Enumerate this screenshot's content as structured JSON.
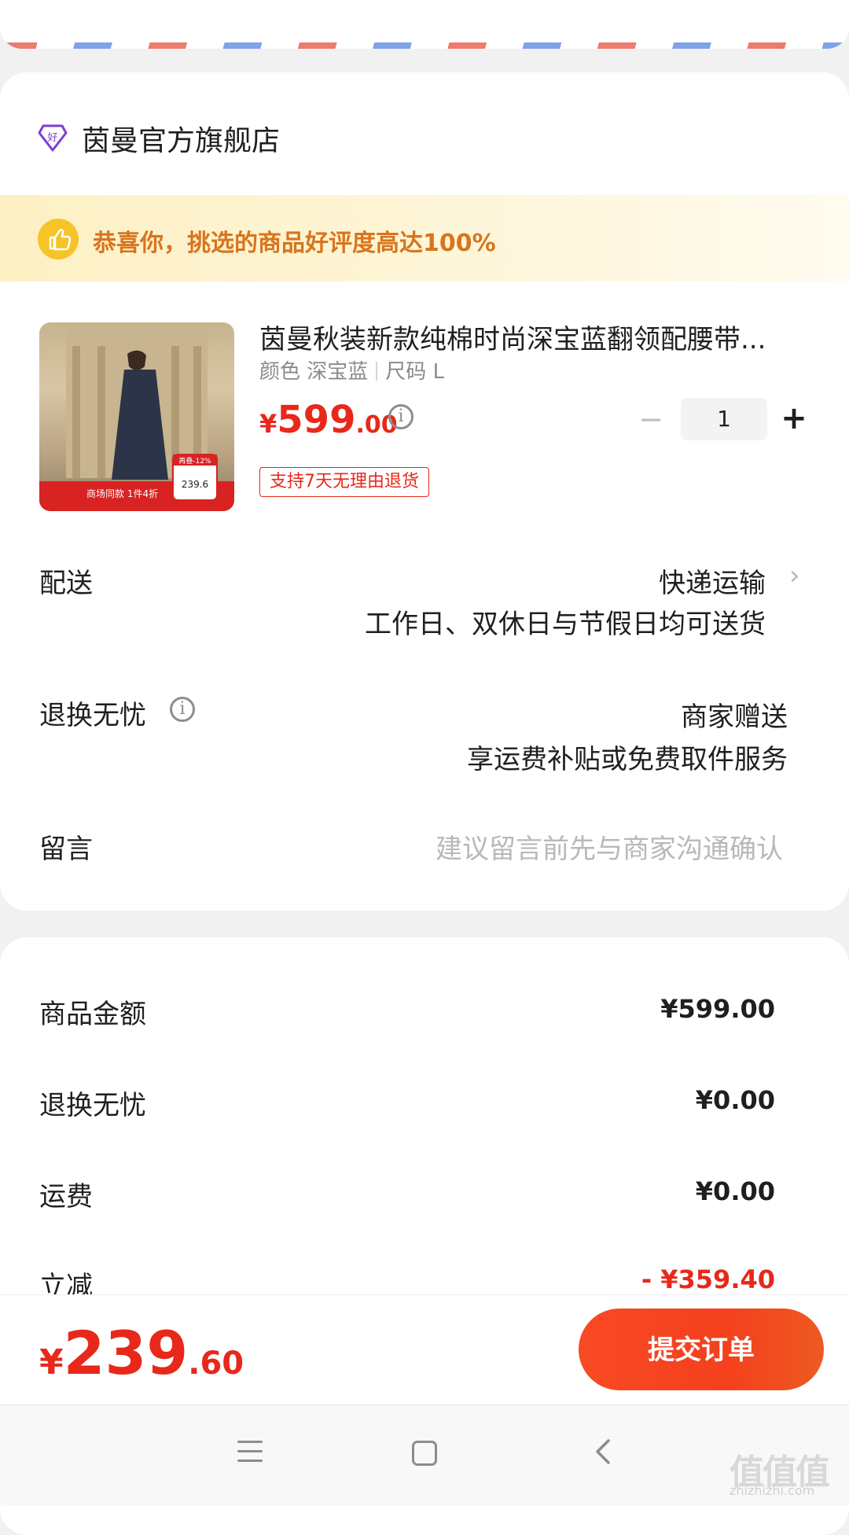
{
  "store": {
    "name": "茵曼官方旗舰店",
    "banner_text": "恭喜你，挑选的商品好评度高达100%",
    "accent_color": "#e8281a"
  },
  "product": {
    "title": "茵曼秋装新款纯棉时尚深宝蓝翻领配腰带...",
    "spec_color_label": "颜色",
    "spec_color_value": "深宝蓝",
    "spec_size_label": "尺码",
    "spec_size_value": "L",
    "price_currency": "¥",
    "price_int": "599",
    "price_dec": ".00",
    "quantity": "1",
    "minus_symbol": "−",
    "plus_symbol": "+",
    "return_tag": "支持7天无理由退货",
    "image_overlay": {
      "badge": "再叠-12%",
      "banner": "商场同款 1件4折",
      "price": "239.6"
    }
  },
  "delivery": {
    "label": "配送",
    "method": "快递运输",
    "detail": "工作日、双休日与节假日均可送货",
    "chevron": "›"
  },
  "worry_free": {
    "label": "退换无忧",
    "info_symbol": "i",
    "value": "商家赠送",
    "detail": "享运费补贴或免费取件服务"
  },
  "note": {
    "label": "留言",
    "placeholder": "建议留言前先与商家沟通确认"
  },
  "summary": {
    "items": [
      {
        "label": "商品金额",
        "value": "¥599.00"
      },
      {
        "label": "退换无忧",
        "value": "¥0.00"
      },
      {
        "label": "运费",
        "value": "¥0.00"
      },
      {
        "label": "立减",
        "value": "- ¥359.40"
      }
    ]
  },
  "footer": {
    "total_currency": "¥",
    "total_int": "239",
    "total_dec": ".60",
    "submit_label": "提交订单"
  },
  "watermark": {
    "main": "值值值",
    "sub": "zhizhizhi.com"
  },
  "icons": [
    "store-badge-icon",
    "thumbs-up-icon",
    "info-icon",
    "chevron-right-icon",
    "menu-icon",
    "home-icon",
    "back-icon"
  ]
}
